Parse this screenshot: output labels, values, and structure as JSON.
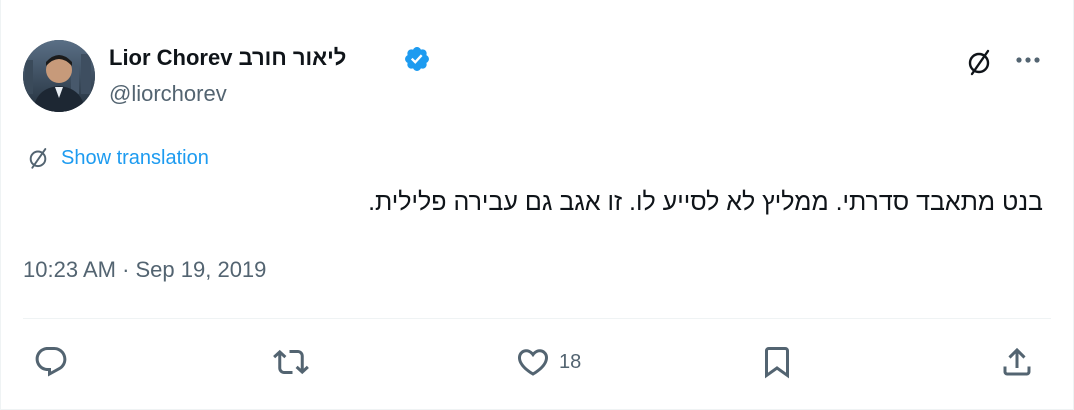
{
  "tweet": {
    "display_name": "Lior Chorev ליאור חורב",
    "handle": "@liorchorev",
    "verified": true,
    "avatar_icon": "avatar-photo",
    "translate_label": "Show translation",
    "text": "בנט מתאבד סדרתי.  ממליץ לא לסייע לו.  זו אגב גם עבירה פלילית.",
    "timestamp": "10:23 AM · Sep 19, 2019",
    "likes": "18"
  },
  "colors": {
    "accent": "#1d9bf0",
    "text_primary": "#0f1419",
    "text_secondary": "#536471",
    "divider": "#eff3f4"
  },
  "icons": {
    "header": [
      "translate-icon",
      "more-icon"
    ],
    "actions": [
      "reply-icon",
      "retweet-icon",
      "like-icon",
      "bookmark-icon",
      "share-icon"
    ]
  }
}
